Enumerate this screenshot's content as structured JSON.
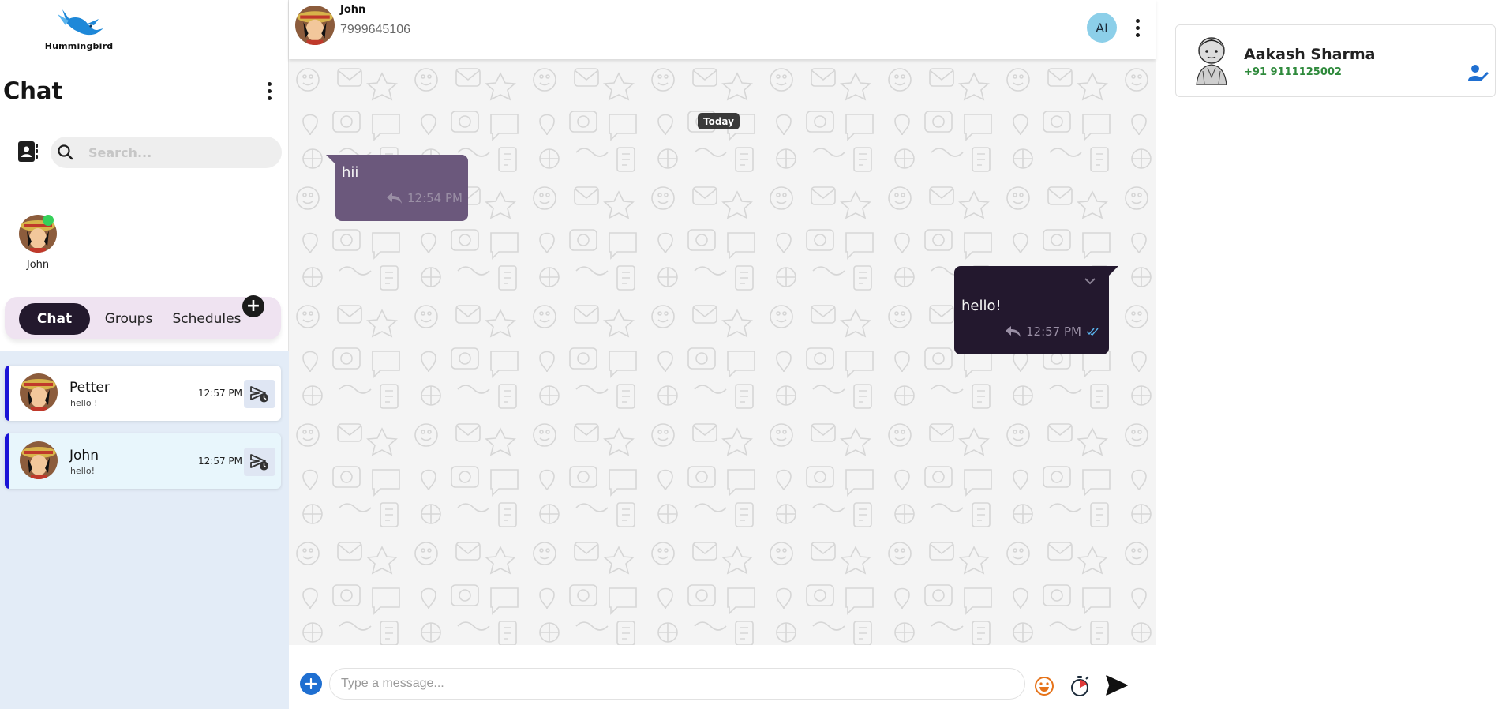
{
  "brand": {
    "name": "Hummingbird"
  },
  "sidebar": {
    "title": "Chat",
    "search": {
      "placeholder": "Search...",
      "value": ""
    },
    "stories": [
      {
        "name": "John",
        "online": true
      }
    ],
    "tabs": [
      {
        "label": "Chat",
        "active": true
      },
      {
        "label": "Groups"
      },
      {
        "label": "Schedules"
      }
    ],
    "add_label": "+",
    "chats": [
      {
        "name": "Petter",
        "preview": "hello !",
        "time": "12:57 PM"
      },
      {
        "name": "John",
        "preview": "hello!",
        "time": "12:57 PM",
        "selected": true
      }
    ]
  },
  "chat": {
    "contact_name": "John",
    "contact_phone": "7999645106",
    "ai_label": "AI",
    "date_divider": "Today",
    "messages": [
      {
        "direction": "incoming",
        "text": "hii",
        "time": "12:54 PM"
      },
      {
        "direction": "outgoing",
        "text": "hello!",
        "time": "12:57 PM",
        "status": "read"
      }
    ],
    "composer": {
      "placeholder": "Type a message..."
    }
  },
  "profile": {
    "name": "Aakash Sharma",
    "phone": "+91 9111125002"
  },
  "colors": {
    "accent_dark": "#23192d",
    "incoming_bubble": "#6b587c",
    "outgoing_bubble": "#23182e",
    "chat_item_border": "#1a12d6",
    "online": "#35d05a",
    "phone_green": "#2f8a3c"
  },
  "icons": [
    "hummingbird-logo-icon",
    "contacts-book-icon",
    "search-icon",
    "kebab-menu-icon",
    "plus-icon",
    "schedule-send-icon",
    "reply-icon",
    "double-check-icon",
    "chevron-down-icon",
    "emoji-icon",
    "timer-icon",
    "send-icon",
    "edit-contact-icon"
  ]
}
